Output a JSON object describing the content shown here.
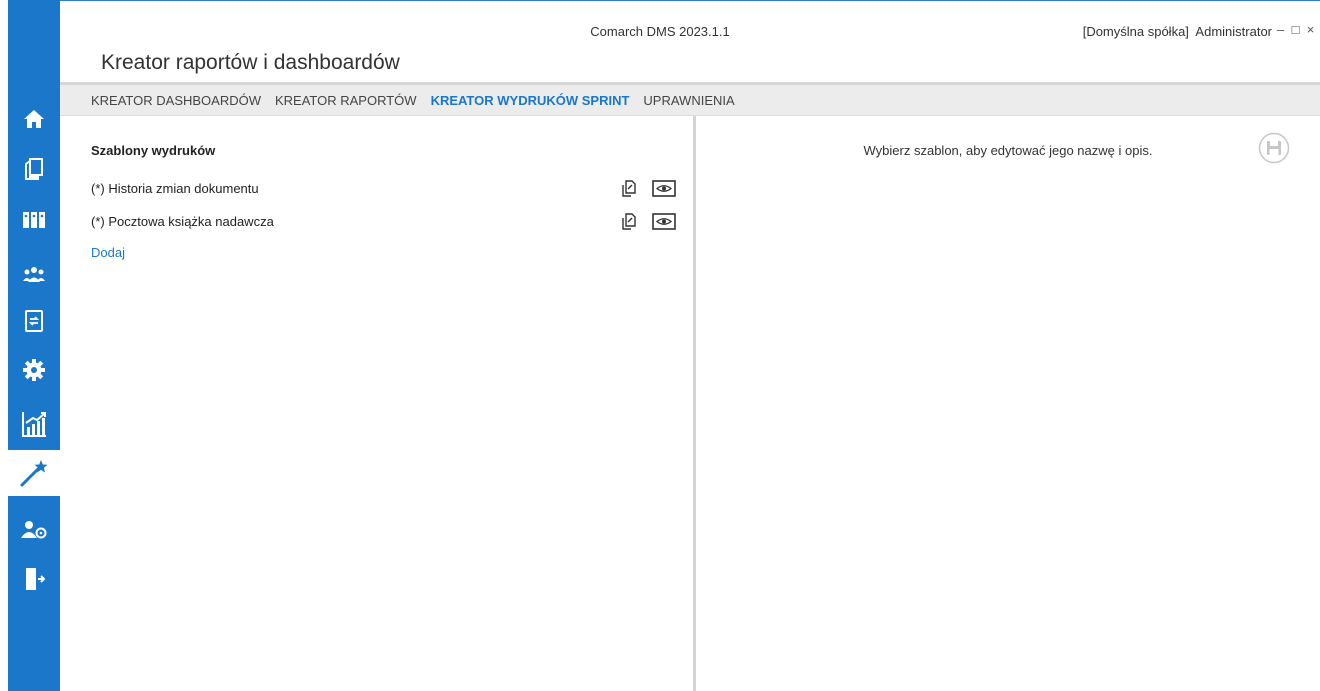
{
  "window": {
    "app_title": "Comarch DMS 2023.1.1",
    "company_user": "[Domyślna spółka]  Administrator",
    "minimize_glyph": "–",
    "maximize_glyph": "□",
    "close_glyph": "×"
  },
  "page": {
    "title": "Kreator raportów i dashboardów"
  },
  "tabs": [
    {
      "label": "KREATOR DASHBOARDÓW",
      "active": false
    },
    {
      "label": "KREATOR RAPORTÓW",
      "active": false
    },
    {
      "label": "KREATOR WYDRUKÓW SPRINT",
      "active": true
    },
    {
      "label": "UPRAWNIENIA",
      "active": false
    }
  ],
  "sidebar": {
    "items": [
      {
        "icon": "home-icon",
        "active": false
      },
      {
        "icon": "documents-icon",
        "active": false
      },
      {
        "icon": "binders-icon",
        "active": false
      },
      {
        "icon": "users-icon",
        "active": false
      },
      {
        "icon": "workflow-document-icon",
        "active": false
      },
      {
        "icon": "gear-icon",
        "active": false
      },
      {
        "icon": "chart-icon",
        "active": false
      },
      {
        "icon": "magic-wand-icon",
        "active": true
      },
      {
        "icon": "user-settings-icon",
        "active": false
      },
      {
        "icon": "logout-icon",
        "active": false
      }
    ]
  },
  "templates": {
    "heading": "Szablony wydruków",
    "items": [
      {
        "label": "(*) Historia zmian dokumentu"
      },
      {
        "label": "(*) Pocztowa książka nadawcza"
      }
    ],
    "add_label": "Dodaj"
  },
  "editor": {
    "hint": "Wybierz szablon, aby edytować jego nazwę i opis."
  },
  "colors": {
    "accent": "#1a77c9",
    "sidebar_bg": "#1a77c9",
    "tabbar_bg": "#ececec"
  }
}
